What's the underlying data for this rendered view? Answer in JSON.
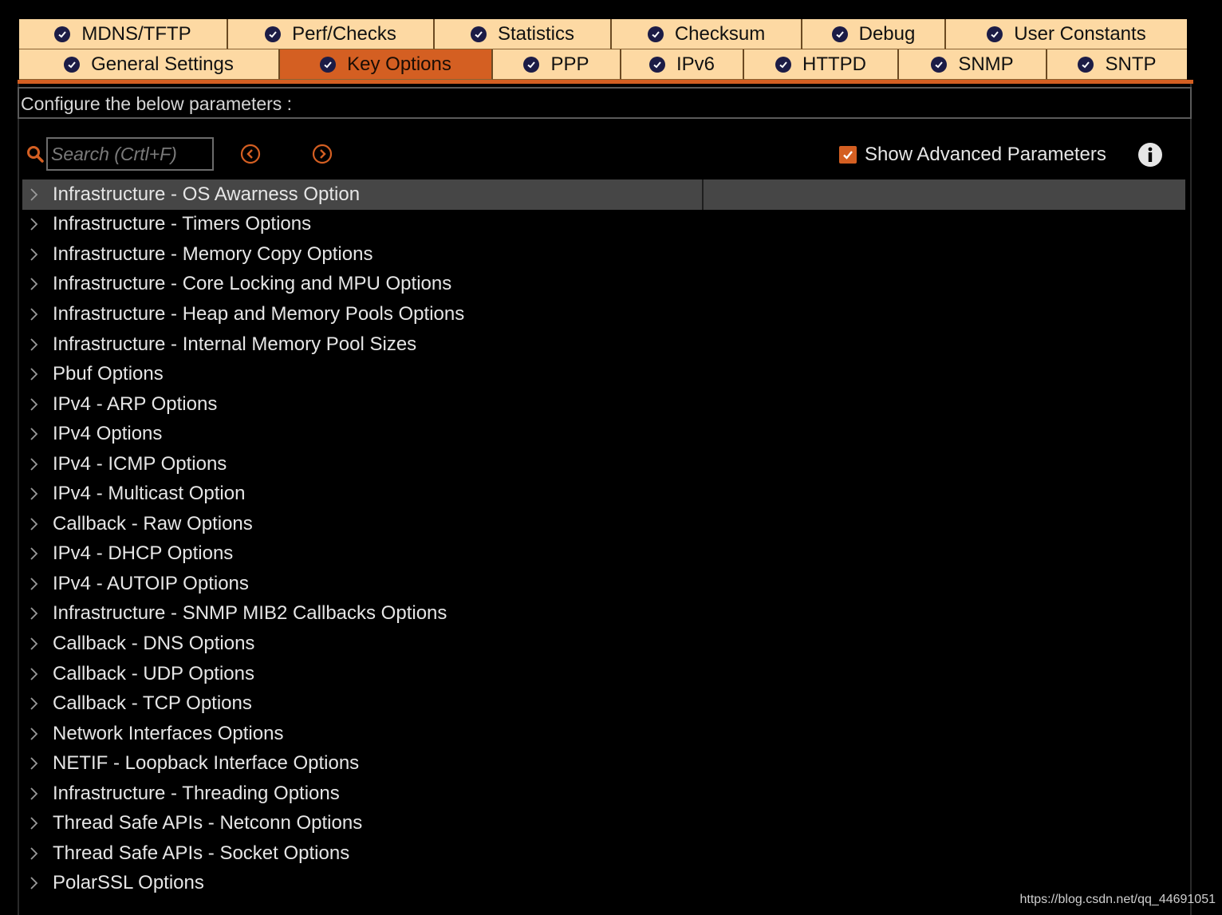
{
  "tabs": {
    "row1": [
      {
        "label": "MDNS/TFTP"
      },
      {
        "label": "Perf/Checks"
      },
      {
        "label": "Statistics"
      },
      {
        "label": "Checksum"
      },
      {
        "label": "Debug"
      },
      {
        "label": "User Constants"
      }
    ],
    "row2": [
      {
        "label": "General Settings"
      },
      {
        "label": "Key Options",
        "active": true
      },
      {
        "label": "PPP"
      },
      {
        "label": "IPv6"
      },
      {
        "label": "HTTPD"
      },
      {
        "label": "SNMP"
      },
      {
        "label": "SNTP"
      }
    ]
  },
  "config": {
    "text": "Configure the below parameters :"
  },
  "search": {
    "placeholder": "Search (Crtl+F)"
  },
  "advanced": {
    "label": "Show Advanced Parameters",
    "checked": true
  },
  "tree": {
    "items": [
      "Infrastructure - OS Awarness Option",
      "Infrastructure - Timers Options",
      "Infrastructure - Memory Copy Options",
      "Infrastructure - Core Locking and MPU Options",
      "Infrastructure - Heap and Memory Pools Options",
      "Infrastructure - Internal Memory Pool Sizes",
      "Pbuf Options",
      "IPv4 - ARP Options",
      "IPv4 Options",
      "IPv4 - ICMP Options",
      "IPv4 - Multicast Option",
      "Callback - Raw Options",
      "IPv4 - DHCP Options",
      "IPv4 - AUTOIP Options",
      "Infrastructure - SNMP MIB2 Callbacks Options",
      "Callback - DNS Options",
      "Callback - UDP Options",
      "Callback - TCP Options",
      "Network Interfaces Options",
      "NETIF - Loopback Interface Options",
      "Infrastructure - Threading Options",
      "Thread Safe APIs - Netconn Options",
      "Thread Safe APIs - Socket Options",
      "PolarSSL Options"
    ],
    "selected_index": 0
  },
  "watermark": {
    "text": "https://blog.csdn.net/qq_44691051"
  },
  "colors": {
    "accent": "#d45f22",
    "tab_bg": "#fdd9a3",
    "check_icon": "#1c1c46"
  }
}
